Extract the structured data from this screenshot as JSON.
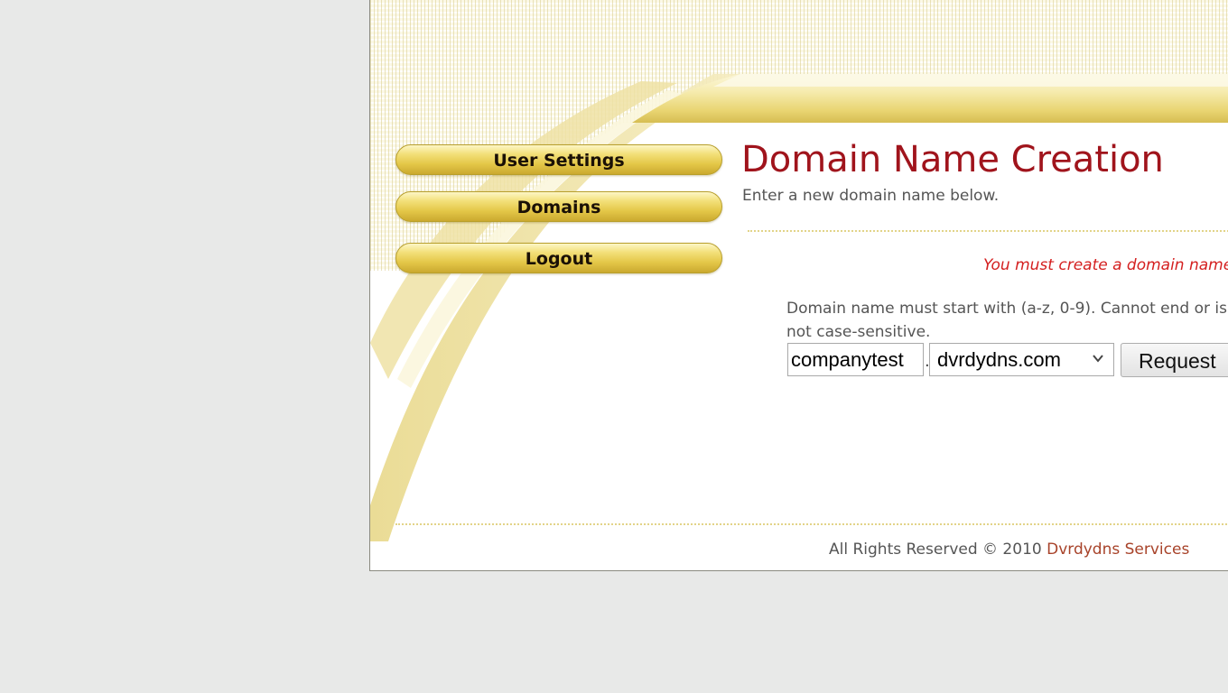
{
  "nav": {
    "items": [
      {
        "label": "User Settings"
      },
      {
        "label": "Domains"
      },
      {
        "label": "Logout"
      }
    ]
  },
  "main": {
    "title": "Domain Name Creation",
    "subtitle": "Enter a new domain name below.",
    "error": "You must create a domain name",
    "rules": "Domain name must start with (a-z, 0-9). Cannot end or is not case-sensitive.",
    "form": {
      "host_value": "companytest",
      "separator": ".",
      "selected_domain": "dvrdydns.com",
      "request_label": "Request"
    }
  },
  "footer": {
    "text": "All Rights Reserved © 2010 ",
    "link_text": "Dvrdydns Services"
  },
  "colors": {
    "title": "#a0141c",
    "error": "#d42020",
    "link": "#a8432a",
    "nav_gold": "#e4c748"
  }
}
